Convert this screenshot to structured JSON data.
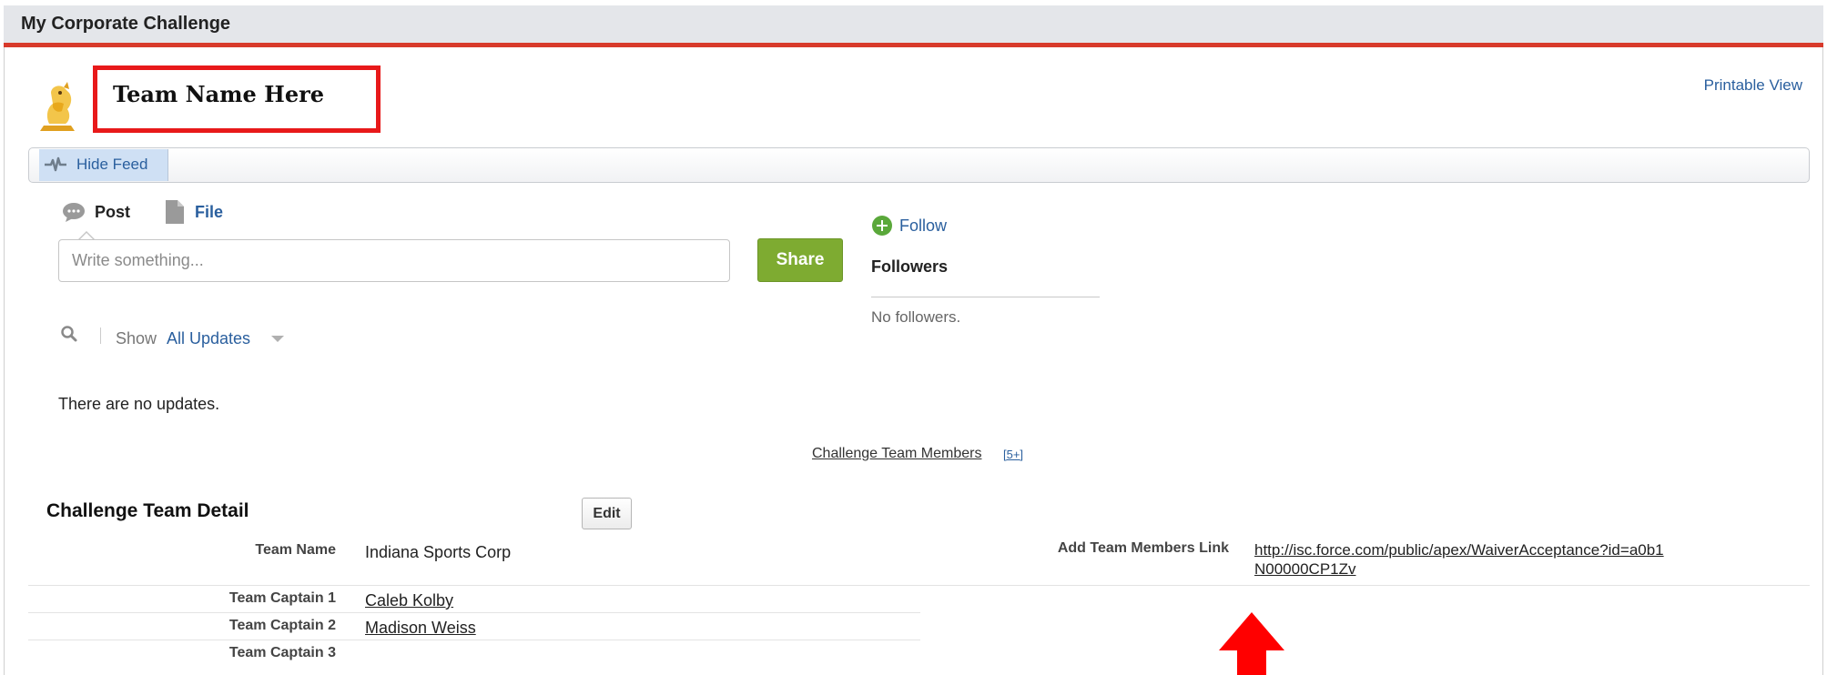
{
  "tab": {
    "title": "My Corporate Challenge"
  },
  "header": {
    "title": "Team Name Here",
    "printable_view": "Printable View"
  },
  "feed_toggle": {
    "label": "Hide Feed"
  },
  "publisher": {
    "post_tab": "Post",
    "file_tab": "File",
    "input_placeholder": "Write something...",
    "share_label": "Share"
  },
  "feed_filter": {
    "show_label": "Show",
    "selected": "All Updates",
    "empty_message": "There are no updates."
  },
  "followers": {
    "follow_label": "Follow",
    "heading": "Followers",
    "empty_message": "No followers."
  },
  "related_list": {
    "link": "Challenge Team Members",
    "count": "[5+]"
  },
  "detail": {
    "section_title": "Challenge Team Detail",
    "edit_label": "Edit",
    "fields": [
      {
        "label": "Team Name",
        "value": "Indiana Sports Corp"
      },
      {
        "label": "Team Captain 1",
        "value": "Caleb Kolby"
      },
      {
        "label": "Team Captain 2",
        "value": "Madison Weiss"
      },
      {
        "label": "Team Captain 3",
        "value": ""
      }
    ],
    "add_members": {
      "label": "Add Team Members Link",
      "url": "http://isc.force.com/public/apex/WaiverAcceptance?id=a0b1N00000CP1Zv"
    }
  },
  "colors": {
    "accent_red": "#d83a2b",
    "annotation_red": "#e8191a",
    "link_blue": "#2a5f9e",
    "share_green": "#7eab31"
  },
  "icons": [
    "avatar-icon",
    "feed-icon",
    "post-bubble-icon",
    "file-icon",
    "search-icon",
    "follow-plus-icon",
    "dropdown-caret-icon",
    "annotation-arrow-icon"
  ]
}
